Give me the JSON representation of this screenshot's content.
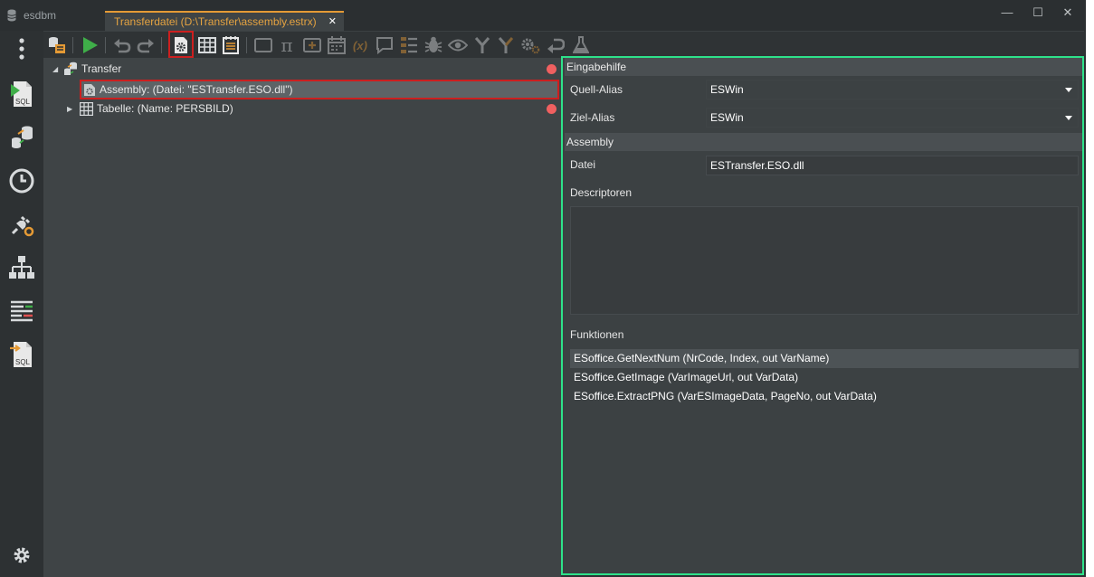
{
  "titlebar": {
    "app_name": "esdbm",
    "doc_tab_title": "Transferdatei (D:\\Transfer\\assembly.estrx)",
    "close_tab_glyph": "✕",
    "minimize_glyph": "—",
    "maximize_glyph": "☐",
    "close_glyph": "✕"
  },
  "sidebar": {
    "items": [
      {
        "icon": "more-vertical-icon"
      },
      {
        "icon": "sql-run-icon",
        "text": "SQL"
      },
      {
        "icon": "database-transfer-icon"
      },
      {
        "icon": "clock-icon"
      },
      {
        "icon": "plug-gear-icon"
      },
      {
        "icon": "hierarchy-icon"
      },
      {
        "icon": "compare-lines-icon"
      },
      {
        "icon": "sql-import-icon",
        "text": "SQL"
      },
      {
        "icon": "settings-gear-icon"
      }
    ]
  },
  "toolbar": {
    "items": [
      "database-list-icon",
      "run-icon",
      "undo-icon",
      "redo-icon",
      "assembly-gear-icon",
      "table-icon",
      "notepad-icon",
      "rectangle-icon",
      "pi-icon",
      "add-box-icon",
      "calendar-icon",
      "variable-icon",
      "comment-icon",
      "list-icon",
      "bug-icon",
      "eye-icon",
      "merge-icon",
      "branch-icon",
      "gears-icon",
      "return-icon",
      "flask-icon"
    ],
    "text": {
      "pi": "π",
      "variable": "(x)"
    }
  },
  "tree": {
    "root": {
      "label": "Transfer"
    },
    "children": [
      {
        "label": "Assembly: (Datei: \"ESTransfer.ESO.dll\")"
      },
      {
        "label": "Tabelle: (Name: PERSBILD)"
      }
    ]
  },
  "props": {
    "section_input": "Eingabehilfe",
    "quell_alias": {
      "label": "Quell-Alias",
      "value": "ESWin"
    },
    "ziel_alias": {
      "label": "Ziel-Alias",
      "value": "ESWin"
    },
    "section_assembly": "Assembly",
    "datei": {
      "label": "Datei",
      "value": "ESTransfer.ESO.dll"
    },
    "descriptoren_label": "Descriptoren",
    "funktionen_label": "Funktionen",
    "funktionen": [
      "ESoffice.GetNextNum (NrCode, Index, out VarName)",
      "ESoffice.GetImage (VarImageUrl, out VarData)",
      "ESoffice.ExtractPNG (VarESImageData, PageNo, out VarData)"
    ]
  },
  "colors": {
    "accent_tab": "#e5a341",
    "highlight_red": "#cc1f1f",
    "panel_border_green": "#2ee28a",
    "status_dot_red": "#f06060",
    "run_green": "#3fae49"
  }
}
